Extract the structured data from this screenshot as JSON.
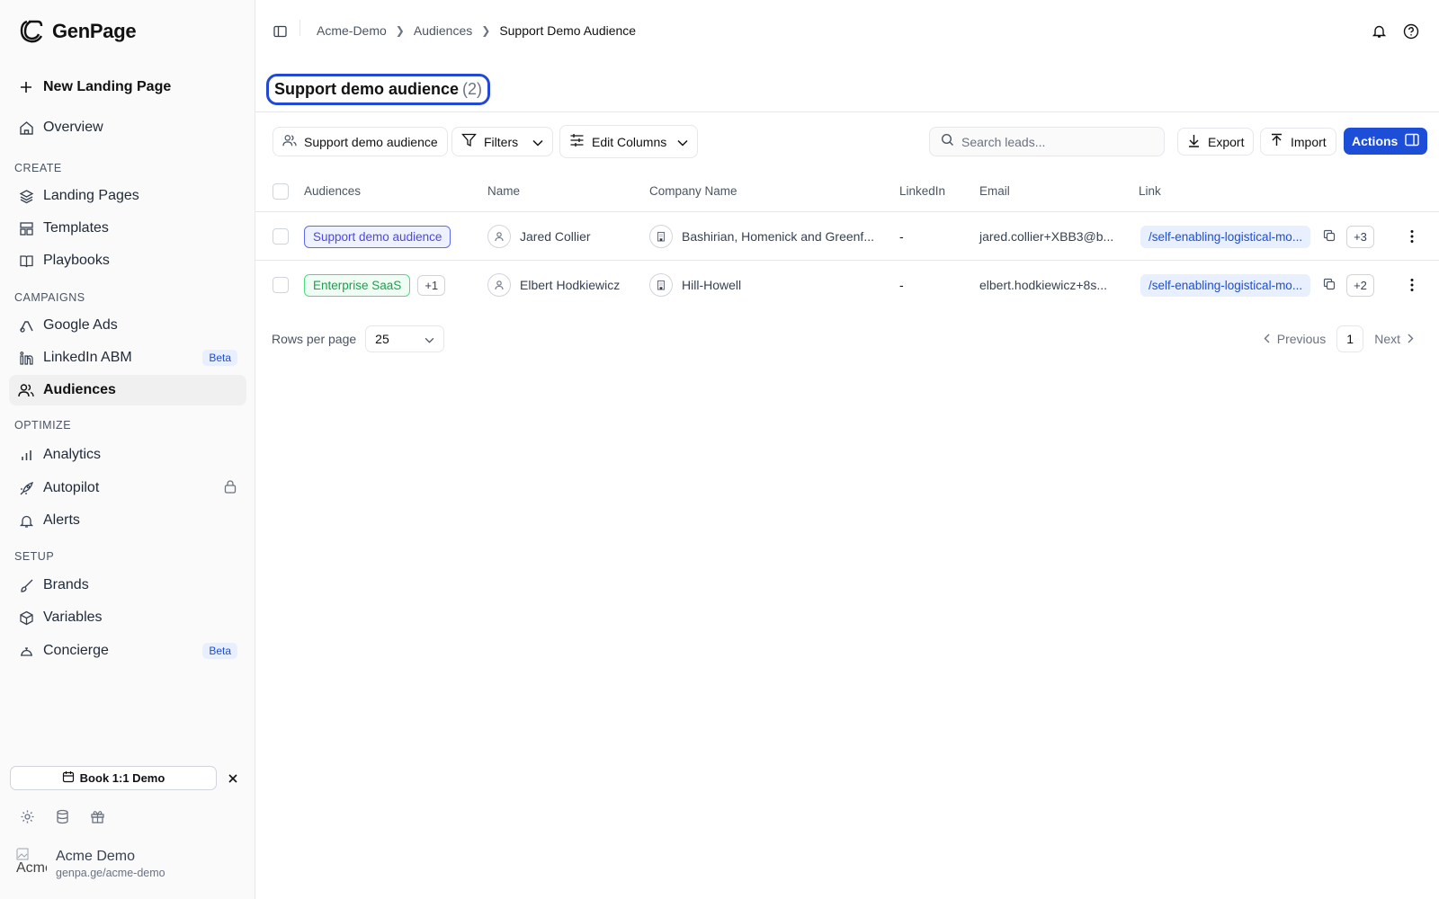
{
  "brand": {
    "name": "GenPage"
  },
  "sidebar": {
    "new_page": "New Landing Page",
    "overview": "Overview",
    "sections": {
      "create": "CREATE",
      "campaigns": "CAMPAIGNS",
      "optimize": "OPTIMIZE",
      "setup": "SETUP"
    },
    "items": {
      "landing_pages": "Landing Pages",
      "templates": "Templates",
      "playbooks": "Playbooks",
      "google_ads": "Google Ads",
      "linkedin_abm": "LinkedIn ABM",
      "audiences": "Audiences",
      "analytics": "Analytics",
      "autopilot": "Autopilot",
      "alerts": "Alerts",
      "brands": "Brands",
      "variables": "Variables",
      "concierge": "Concierge"
    },
    "beta_label": "Beta",
    "demo_button": "Book 1:1 Demo",
    "account": {
      "name": "Acme Demo",
      "url": "genpa.ge/acme-demo",
      "avatar_alt": "Acme"
    }
  },
  "breadcrumb": [
    "Acme-Demo",
    "Audiences",
    "Support Demo Audience"
  ],
  "page": {
    "title": "Support demo audience",
    "count": "(2)"
  },
  "toolbar": {
    "audience_filter": "Support demo audience",
    "filters": "Filters",
    "edit_columns": "Edit Columns",
    "search_placeholder": "Search leads...",
    "export": "Export",
    "import": "Import",
    "actions": "Actions"
  },
  "table": {
    "columns": [
      "Audiences",
      "Name",
      "Company Name",
      "LinkedIn",
      "Email",
      "Link"
    ],
    "rows": [
      {
        "audience": "Support demo audience",
        "audience_color": "blue",
        "extra_audiences": "",
        "name": "Jared Collier",
        "company": "Bashirian, Homenick and Greenf...",
        "linkedin": "-",
        "email": "jared.collier+XBB3@b...",
        "link": "/self-enabling-logistical-mo...",
        "link_extra": "+3"
      },
      {
        "audience": "Enterprise SaaS",
        "audience_color": "green",
        "extra_audiences": "+1",
        "name": "Elbert Hodkiewicz",
        "company": "Hill-Howell",
        "linkedin": "-",
        "email": "elbert.hodkiewicz+8s...",
        "link": "/self-enabling-logistical-mo...",
        "link_extra": "+2"
      }
    ]
  },
  "pagination": {
    "rows_per_page_label": "Rows per page",
    "rows_per_page": "25",
    "previous": "Previous",
    "page": "1",
    "next": "Next"
  },
  "colors": {
    "accent": "#1d4ed8",
    "highlight_border": "#2249d6"
  }
}
